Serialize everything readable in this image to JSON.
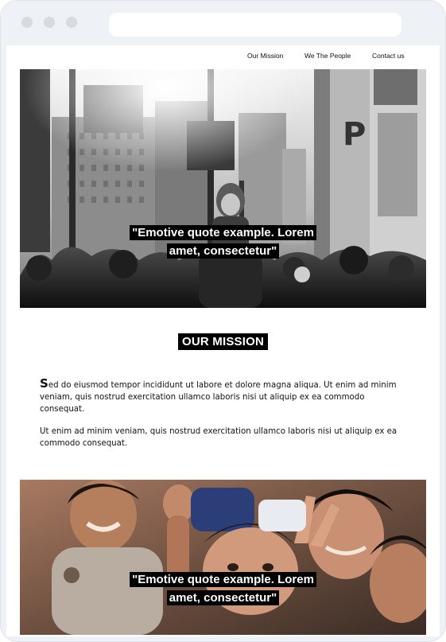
{
  "nav": {
    "items": [
      "Our Mission",
      "We The People",
      "Contact us"
    ]
  },
  "hero": {
    "quote_line1": "\"Emotive quote example. Lorem",
    "quote_line2": "amet, consectetur\""
  },
  "mission": {
    "title": "OUR MISSION",
    "para1_dropcap": "S",
    "para1_rest": "ed do eiusmod tempor incididunt ut labore et dolore magna aliqua. Ut enim ad minim veniam, quis nostrud exercitation ullamco laboris nisi ut aliquip ex ea commodo consequat.",
    "para2": "Ut enim ad minim veniam, quis nostrud exercitation ullamco laboris nisi ut aliquip ex ea commodo consequat."
  },
  "hero2": {
    "quote_line1": "\"Emotive quote example. Lorem",
    "quote_line2": "amet, consectetur\""
  }
}
